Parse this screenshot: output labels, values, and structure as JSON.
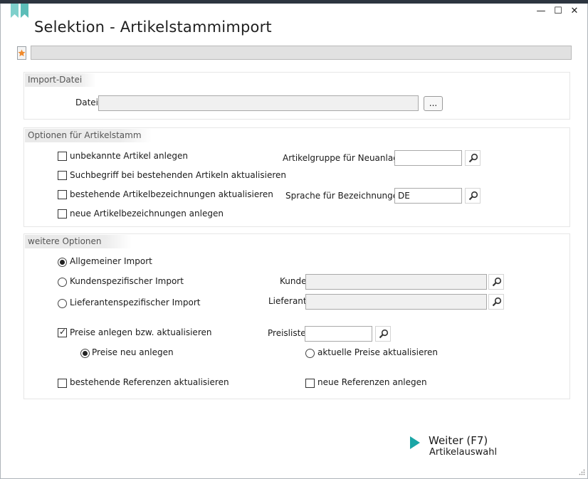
{
  "window": {
    "title": "Selektion - Artikelstammimport",
    "minimize_glyph": "—",
    "maximize_glyph": "☐",
    "close_glyph": "✕",
    "accent_color": "#1aa6a6"
  },
  "import_file": {
    "header": "Import-Datei",
    "file_label": "Datei",
    "file_value": "",
    "browse_label": "..."
  },
  "article_options": {
    "header": "Optionen für Artikelstamm",
    "checkboxes": [
      {
        "label": "unbekannte Artikel anlegen",
        "checked": false
      },
      {
        "label": "Suchbegriff bei bestehenden Artikeln aktualisieren",
        "checked": false
      },
      {
        "label": "bestehende Artikelbezeichnungen aktualisieren",
        "checked": false
      },
      {
        "label": "neue Artikelbezeichnungen anlegen",
        "checked": false
      }
    ],
    "article_group_label": "Artikelgruppe für Neuanlage",
    "article_group_value": "",
    "language_label": "Sprache für Bezeichnungen",
    "language_value": "DE"
  },
  "further_options": {
    "header": "weitere Optionen",
    "import_types": [
      {
        "label": "Allgemeiner Import",
        "selected": true
      },
      {
        "label": "Kundenspezifischer Import",
        "selected": false
      },
      {
        "label": "Lieferantenspezifischer Import",
        "selected": false
      }
    ],
    "customer_label": "Kunde",
    "customer_value": "",
    "supplier_label": "Lieferant",
    "supplier_value": "",
    "prices_label": "Preise anlegen bzw. aktualisieren",
    "prices_checked": true,
    "pricelist_label": "Preisliste",
    "pricelist_value": "",
    "price_new_label": "Preise neu anlegen",
    "price_new_selected": true,
    "price_update_label": "aktuelle Preise aktualisieren",
    "price_update_selected": false,
    "refs_update_label": "bestehende Referenzen aktualisieren",
    "refs_update_checked": false,
    "refs_new_label": "neue Referenzen anlegen",
    "refs_new_checked": false
  },
  "footer": {
    "next_label": "Weiter (F7)",
    "next_sub": "Artikelauswahl"
  }
}
